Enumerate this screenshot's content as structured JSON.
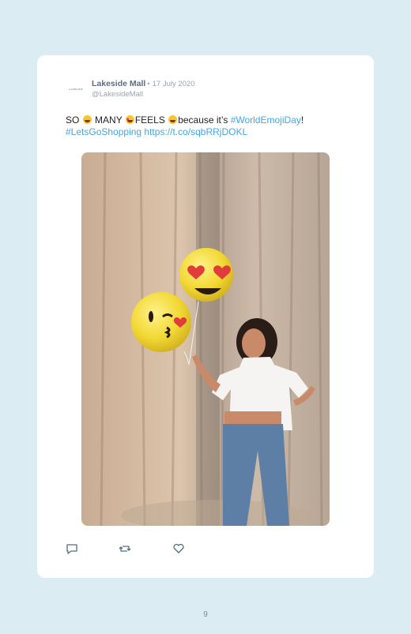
{
  "colors": {
    "background": "#dcecf3",
    "link": "#3fa7e8",
    "card": "#ffffff"
  },
  "tweet_card": {
    "avatar_text": "LAKESIDE",
    "author_name": "Lakeside Mall",
    "separator": "•",
    "date": "17 July 2020",
    "handle": "@LakesideMall",
    "text_parts": {
      "so": "SO",
      "many": "MANY",
      "feels": "FEELS",
      "because": "because it’s",
      "hashtag1": "#WorldEmojiDay",
      "bang": "!",
      "hashtag2": "#LetsGoShopping",
      "url": "https://t.co/sqbRRjDOKL"
    },
    "icons": {
      "reply": "reply-icon",
      "retweet": "retweet-icon",
      "like": "like-icon"
    }
  },
  "footer": {
    "page_number": "9"
  }
}
